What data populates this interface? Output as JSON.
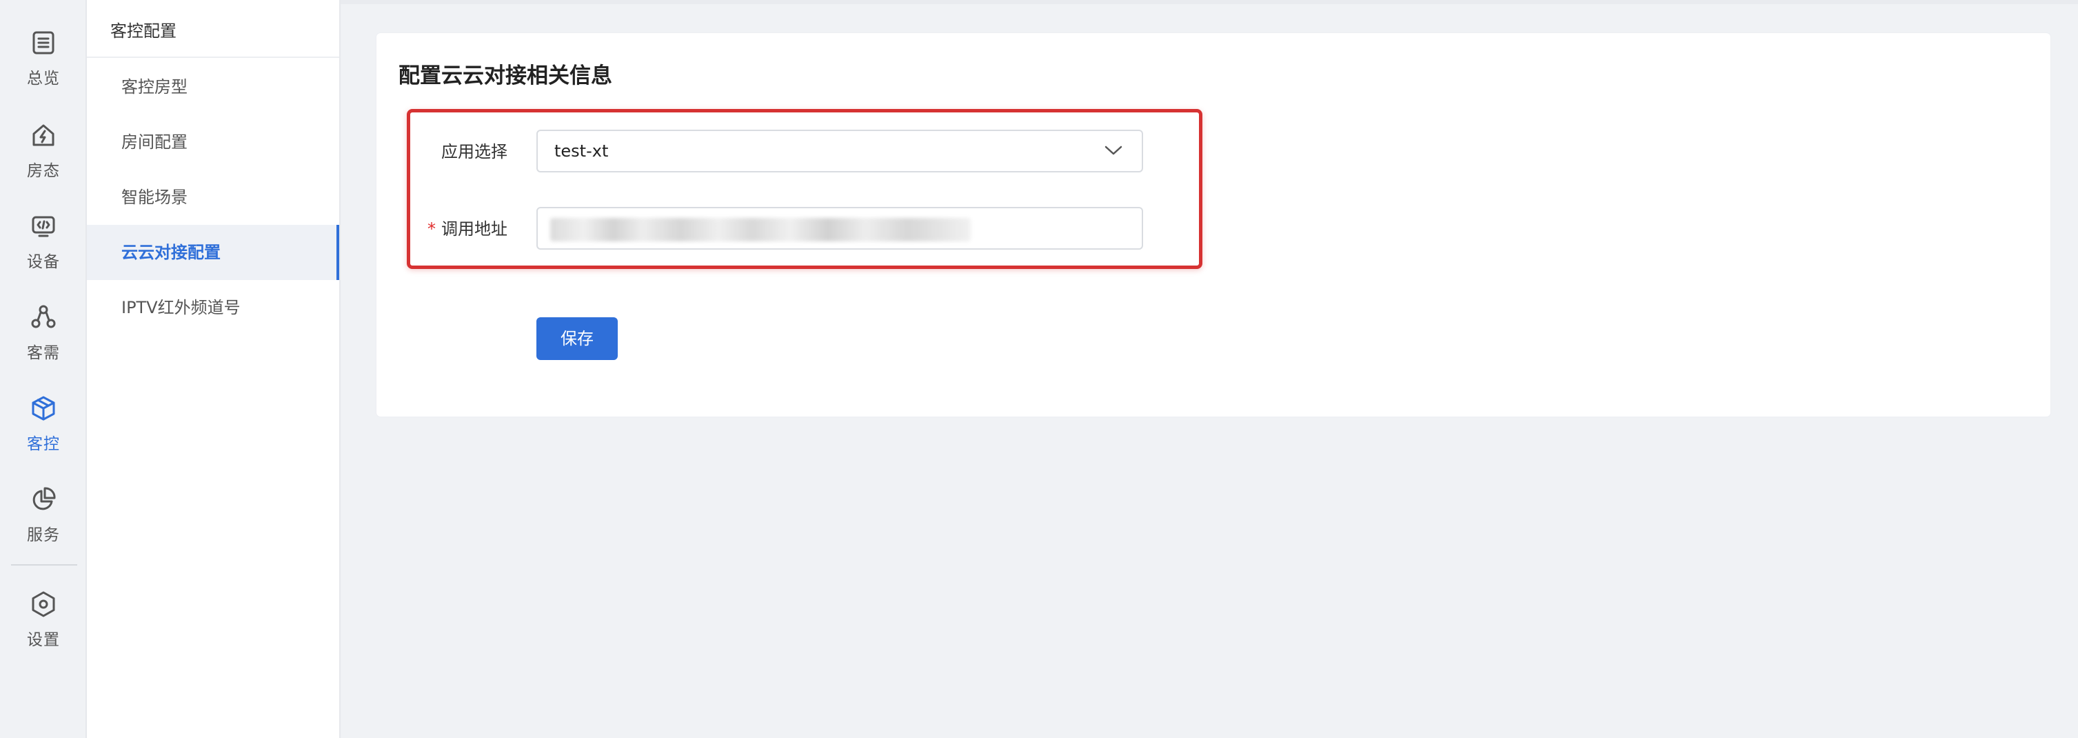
{
  "rail": {
    "items": [
      {
        "label": "总览",
        "icon": "overview-icon"
      },
      {
        "label": "房态",
        "icon": "room-status-icon"
      },
      {
        "label": "设备",
        "icon": "device-icon"
      },
      {
        "label": "客需",
        "icon": "guest-needs-icon"
      },
      {
        "label": "客控",
        "icon": "guest-control-icon"
      },
      {
        "label": "服务",
        "icon": "service-icon"
      },
      {
        "label": "设置",
        "icon": "settings-icon"
      }
    ],
    "active": "客控"
  },
  "submenu": {
    "title": "客控配置",
    "items": [
      {
        "label": "客控房型"
      },
      {
        "label": "房间配置"
      },
      {
        "label": "智能场景"
      },
      {
        "label": "云云对接配置"
      },
      {
        "label": "IPTV红外频道号"
      }
    ],
    "active": "云云对接配置"
  },
  "main": {
    "title": "配置云云对接相关信息",
    "form": {
      "app_select_label": "应用选择",
      "app_select_value": "test-xt",
      "address_label": "调用地址",
      "address_required_mark": "*",
      "save_label": "保存"
    }
  },
  "colors": {
    "accent": "#2f6fd9",
    "highlight": "#d63232",
    "required": "#e02d2d"
  }
}
